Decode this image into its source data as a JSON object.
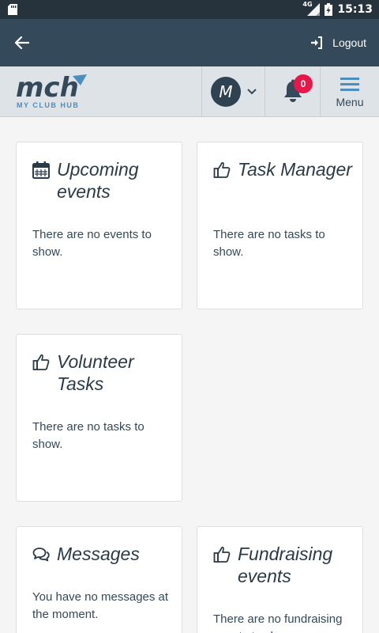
{
  "status_bar": {
    "network": "4G",
    "time": "15:13"
  },
  "app_bar": {
    "logout_label": "Logout"
  },
  "header": {
    "logo_text": "mch",
    "logo_tagline": "MY CLUB HUB",
    "avatar_initial": "M",
    "notification_count": "0",
    "menu_label": "Menu"
  },
  "cards": [
    {
      "title": "Upcoming events",
      "text": "There are no events to show.",
      "icon": "calendar-icon"
    },
    {
      "title": "Task Manager",
      "text": "There are no tasks to show.",
      "icon": "thumbs-up-icon"
    },
    {
      "title": "Volunteer Tasks",
      "text": "There are no tasks to show.",
      "icon": "thumbs-up-icon"
    },
    {
      "title": "Messages",
      "text": "You have no messages at the moment.",
      "icon": "comments-icon"
    },
    {
      "title": "Fundraising events",
      "text": "There are no fundraising events to show.",
      "icon": "thumbs-up-icon"
    }
  ],
  "colors": {
    "status_bar": "#26323c",
    "app_bar": "#34495a",
    "header": "#dde3e7",
    "badge": "#e8174a",
    "accent": "#4a8fbf"
  }
}
